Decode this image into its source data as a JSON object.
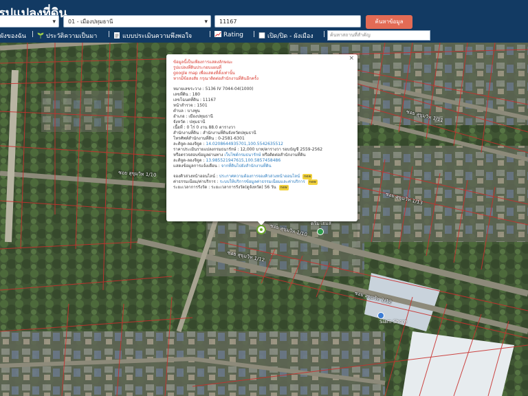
{
  "header": {
    "title": "รูปแปลงที่ดิน",
    "province_select": "",
    "district_select": "01 - เมืองปทุมธานี",
    "parcel_input": "11167",
    "search_button": "ค้นหาข้อมูล"
  },
  "toolbar": {
    "items": [
      "ผังของฉัน",
      "ประวัติความเป็นมา",
      "แบบประเมินความพึงพอใจ",
      "Rating",
      "เปิด/ปิด - ผังเมือง"
    ],
    "place_placeholder": "ค้นหาสถานที่สำคัญ"
  },
  "popup": {
    "warning_lines": [
      "ข้อมูลนี้เป็นเพียงการแสดงลักษณะ",
      "รูปแปลงที่ดินประกอบแผนที่",
      "google map เพื่อแสดงที่ตั้งเท่านั้น",
      "หากมีข้อสงสัย กรุณาติดต่อสำนักงานที่ดินอีกครั้ง"
    ],
    "fields": [
      "หมายเลขระวาง : 5136 IV 7044-04(1000)",
      "เลขที่ดิน : 180",
      "เลขโฉนดที่ดิน : 11167",
      "หน้าสำรวจ : 1501",
      "ตำบล : บางพูน",
      "อำเภอ : เมืองปทุมธานี",
      "จังหวัด : ปทุมธานี",
      "เนื้อที่ : 0 ไร่ 0 งาน 88.0 ตารางวา",
      "สำนักงานที่ดิน : สำนักงานที่ดินจังหวัดปทุมธานี",
      "โทรศัพท์สำนักงานที่ดิน : 0-2581-6301"
    ],
    "office_coord_label": "ละติจูด-ลองจิจูด :",
    "office_coord_value": "14.0208644935701,100.5542635512",
    "appraisal": "ราคาประเมินรายแปลงกรมธนารักษ์ : 12,000 บาท/ตารางวา รอบบัญชี 2559-2562",
    "check_note_pre": "หรือตรวจสอบข้อมูลผ่านทาง",
    "check_note_link": "เว็บไซต์กรมธนารักษ์",
    "check_note_post": "หรือติดต่อสำนักงานที่ดิน",
    "parcel_coord_label": "ละติจูด-ลองจิจูด :",
    "parcel_coord_value": "13.985521947615,100.5857458486",
    "notice_pre": "แสดงข้อมูลการแจ้งเตือน :",
    "notice_link": "จากที่ดินไปยังสำนักงานที่ดิน",
    "queue_label": "จองคิวล่วงหน้าออนไลน์ :",
    "queue_link": "ประกาศความต้องการจองคิวล่วงหน้าออนไลน์",
    "service_label": "ค่าธรรมเนียม/ค่าบริการ :",
    "service_link": "ระบบให้บริการข้อมูลค่าธรรมเนียมและค่าบริการ",
    "time_label": "ระยะเวลาการรังวัด :",
    "time_value": "ระยะเวลาการรังวัด(ดูจังหวัด) 56 วัน",
    "new_badge": "new",
    "close": "×"
  },
  "map": {
    "roads": [
      "ซอย สุขุมวิท 1/10",
      "ซอย สุขุมวิท 1/10",
      "ซอย สุขุมวิท 1/12",
      "ซอย สุขุมวิท 1/12",
      "ซอย สุขุมวิท 1/13",
      "ซอย สุขุมวิท 1/11"
    ],
    "pois": [
      "ดรีมโฮมส์",
      "Siam Shore"
    ]
  },
  "colors": {
    "header_bg": "#123a63",
    "search_btn": "#e36b55",
    "parcel_line": "#c8302d",
    "warning_text": "#d8352a",
    "link": "#2a7bbf"
  }
}
